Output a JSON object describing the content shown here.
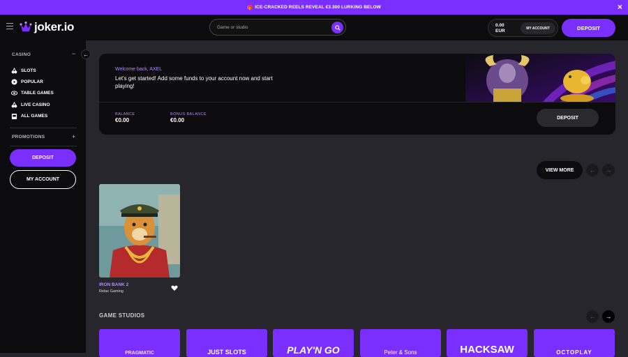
{
  "promo_bar": {
    "icon": "gift-icon",
    "text": "ICE-CRACKED REELS REVEAL €3.300 LURKING BELOW"
  },
  "header": {
    "logo_text": "joker.io",
    "search_placeholder": "Game or studio",
    "balance_amount": "0.00",
    "balance_currency": "EUR",
    "my_account": "MY ACCOUNT",
    "deposit": "DEPOSIT"
  },
  "sidebar": {
    "casino_title": "CASINO",
    "casino_toggle": "−",
    "items": [
      {
        "label": "SLOTS",
        "icon": "cherries-icon"
      },
      {
        "label": "POPULAR",
        "icon": "play-icon"
      },
      {
        "label": "TABLE GAMES",
        "icon": "table-icon"
      },
      {
        "label": "LIVE CASINO",
        "icon": "cherries-icon"
      },
      {
        "label": "ALL GAMES",
        "icon": "slot-machine-icon"
      }
    ],
    "promotions_title": "PROMOTIONS",
    "promotions_toggle": "+",
    "deposit": "DEPOSIT",
    "my_account": "MY ACCOUNT"
  },
  "welcome": {
    "greeting": "Welcome back, AXEL",
    "message": "Let's get started! Add some funds to your account now and start playing!",
    "balance_label": "BALANCE",
    "balance_value": "€0.00",
    "bonus_label": "BONUS BALANCE",
    "bonus_value": "€0.00",
    "deposit": "DEPOSIT"
  },
  "games": {
    "view_more": "VIEW MORE",
    "items": [
      {
        "title": "IRON BANK 2",
        "studio": "Relax Gaming"
      }
    ]
  },
  "studios": {
    "title": "GAME STUDIOS",
    "items": [
      "PRAGMATIC",
      "JUST SLOTS",
      "PLAY'N GO",
      "Peter & Sons",
      "HACKSAW",
      "OCTOPLAY"
    ]
  },
  "colors": {
    "accent": "#7b2fff",
    "bg": "#27262d",
    "panel": "#0c0c0f",
    "highlight_text": "#b38cff"
  }
}
